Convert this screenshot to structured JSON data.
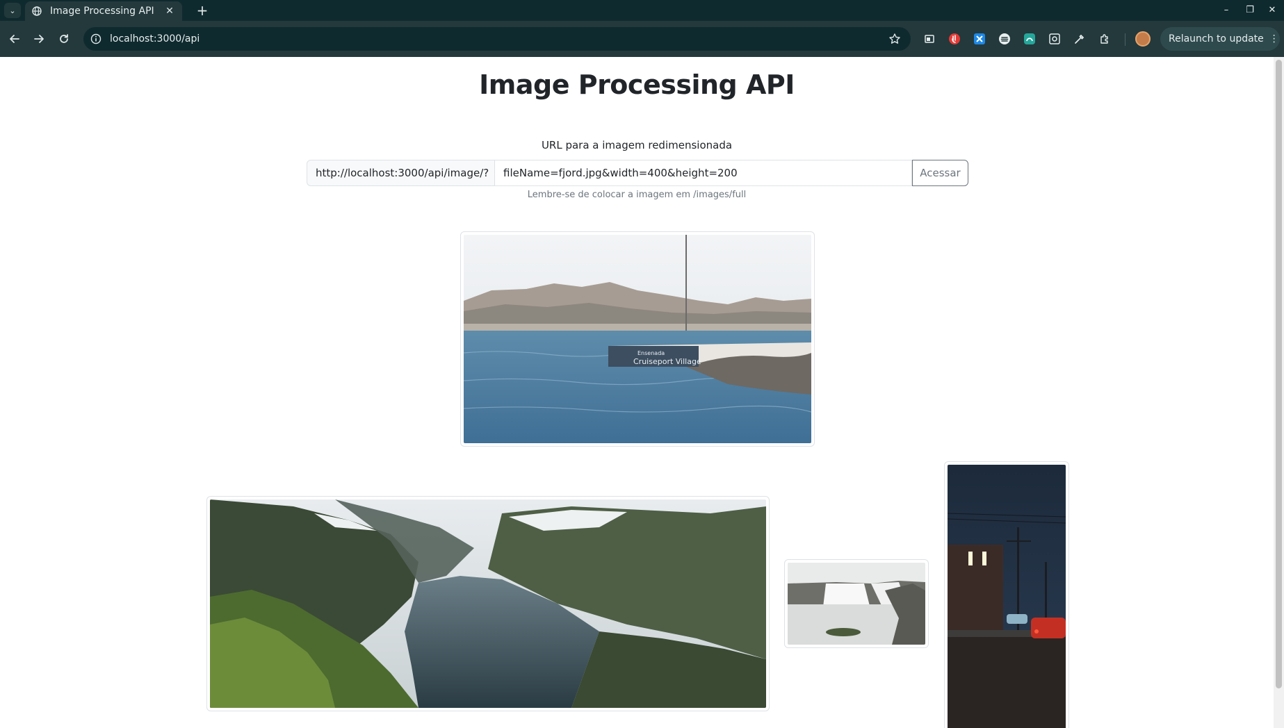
{
  "browser": {
    "tab_title": "Image Processing API",
    "tab_close": "✕",
    "new_tab": "+",
    "address": "localhost:3000/api",
    "relaunch_label": "Relaunch to update",
    "relaunch_menu": "⋮",
    "window_controls": {
      "minimize": "–",
      "maximize": "❐",
      "close": "✕"
    }
  },
  "page": {
    "title": "Image Processing API",
    "url_label": "URL para a imagem redimensionada",
    "url_prefix": "http://localhost:3000/api/image/?",
    "query_value": "fileName=fjord.jpg&width=400&height=200",
    "submit_label": "Acessar",
    "hint": "Lembre-se de colocar a imagem em /images/full"
  },
  "images": {
    "harbor_sign": {
      "line1": "Ensenada",
      "line2": "Cruiseport Village"
    }
  },
  "icons": [
    "tab-search-icon",
    "globe-icon",
    "close-icon",
    "plus-icon",
    "back-icon",
    "forward-icon",
    "reload-icon",
    "site-info-icon",
    "star-icon",
    "extension-icons",
    "profile-avatar",
    "more-icon"
  ],
  "colors": {
    "chrome_dark": "#0f2a2e",
    "chrome_toolbar": "#23393c",
    "text": "#212529",
    "muted": "#6c757d",
    "border": "#dee2e6"
  }
}
